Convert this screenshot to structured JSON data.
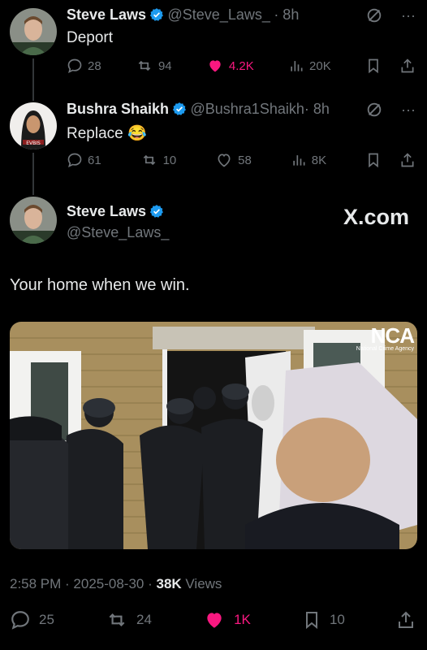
{
  "tweets": [
    {
      "name": "Steve Laws",
      "handle": "@Steve_Laws_",
      "time": "· 8h",
      "text": "Deport",
      "replies": "28",
      "retweets": "94",
      "likes": "4.2K",
      "views": "20K"
    },
    {
      "name": "Bushra Shaikh",
      "handle": "@Bushra1Shaikh",
      "time": "· 8h",
      "text": "Replace 😂",
      "replies": "61",
      "retweets": "10",
      "likes": "58",
      "views": "8K"
    }
  ],
  "main": {
    "name": "Steve Laws",
    "handle": "@Steve_Laws_",
    "brand": "X.com",
    "text": "Your home when we win.",
    "media_logo": "NCA",
    "media_logo_sub": "National Crime Agency",
    "timestamp": "2:58 PM · 2025-08-30 · ",
    "views_count": "38K",
    "views_label": " Views",
    "replies": "25",
    "retweets": "24",
    "likes": "1K",
    "bookmarks": "10"
  },
  "colors": {
    "accent": "#1d9bf0",
    "like": "#f91880",
    "muted": "#71767b"
  }
}
